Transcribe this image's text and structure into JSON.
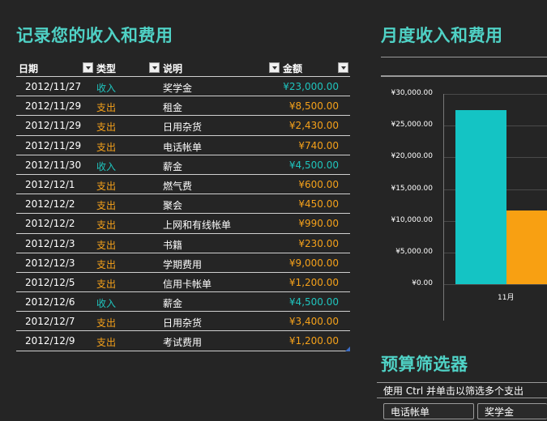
{
  "ledger": {
    "title": "记录您的收入和费用",
    "headers": [
      "日期",
      "类型",
      "说明",
      "金额"
    ],
    "rows": [
      {
        "date": "2012/11/27",
        "type": "收入",
        "desc": "奖学金",
        "amount": "¥23,000.00"
      },
      {
        "date": "2012/11/29",
        "type": "支出",
        "desc": "租金",
        "amount": "¥8,500.00"
      },
      {
        "date": "2012/11/29",
        "type": "支出",
        "desc": "日用杂货",
        "amount": "¥2,430.00"
      },
      {
        "date": "2012/11/29",
        "type": "支出",
        "desc": "电话帐单",
        "amount": "¥740.00"
      },
      {
        "date": "2012/11/30",
        "type": "收入",
        "desc": "薪金",
        "amount": "¥4,500.00"
      },
      {
        "date": "2012/12/1",
        "type": "支出",
        "desc": "燃气费",
        "amount": "¥600.00"
      },
      {
        "date": "2012/12/2",
        "type": "支出",
        "desc": "聚会",
        "amount": "¥450.00"
      },
      {
        "date": "2012/12/2",
        "type": "支出",
        "desc": "上网和有线帐单",
        "amount": "¥990.00"
      },
      {
        "date": "2012/12/3",
        "type": "支出",
        "desc": "书籍",
        "amount": "¥230.00"
      },
      {
        "date": "2012/12/3",
        "type": "支出",
        "desc": "学期费用",
        "amount": "¥9,000.00"
      },
      {
        "date": "2012/12/5",
        "type": "支出",
        "desc": "信用卡帐单",
        "amount": "¥1,200.00"
      },
      {
        "date": "2012/12/6",
        "type": "收入",
        "desc": "薪金",
        "amount": "¥4,500.00"
      },
      {
        "date": "2012/12/7",
        "type": "支出",
        "desc": "日用杂货",
        "amount": "¥3,400.00"
      },
      {
        "date": "2012/12/9",
        "type": "支出",
        "desc": "考试费用",
        "amount": "¥1,200.00"
      }
    ]
  },
  "monthly": {
    "title": "月度收入和费用"
  },
  "chart_data": {
    "type": "bar",
    "categories": [
      "11月"
    ],
    "series": [
      {
        "values": [
          27500
        ],
        "color": "#14c4c4"
      },
      {
        "values": [
          11670
        ],
        "color": "#f8a012"
      }
    ],
    "y_ticks": [
      "¥30,000.00",
      "¥25,000.00",
      "¥20,000.00",
      "¥15,000.00",
      "¥10,000.00",
      "¥5,000.00",
      "¥0.00"
    ],
    "ylim": [
      0,
      30000
    ],
    "grid": true
  },
  "filter": {
    "title": "预算筛选器",
    "note": "使用 Ctrl 并单击以筛选多个支出",
    "slicers": [
      "电话帐单",
      "奖学金"
    ]
  },
  "colors": {
    "income": "#1fc4be",
    "expense": "#f5a11a",
    "accent": "#4fd1c5"
  }
}
